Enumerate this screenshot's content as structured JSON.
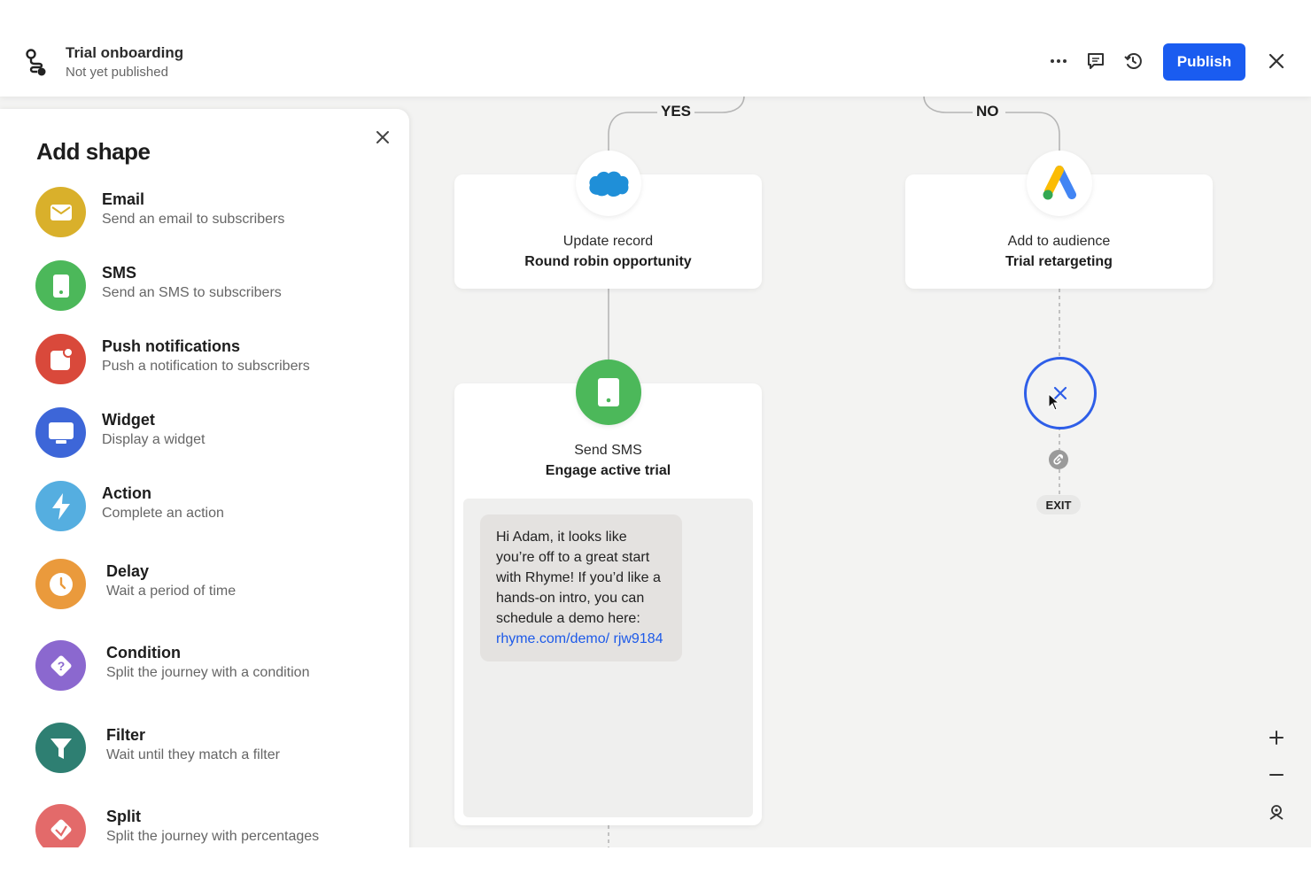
{
  "header": {
    "title": "Trial onboarding",
    "subtitle": "Not yet published",
    "publish_label": "Publish",
    "icons": [
      "flow-icon",
      "more-icon",
      "comment-icon",
      "history-icon",
      "close-icon"
    ]
  },
  "panel": {
    "title": "Add shape",
    "items": [
      {
        "name": "Email",
        "desc": "Send an email to subscribers",
        "icon": "email-icon",
        "color": "#d9b02b"
      },
      {
        "name": "SMS",
        "desc": "Send an SMS to subscribers",
        "icon": "phone-icon",
        "color": "#4cb85a"
      },
      {
        "name": "Push notifications",
        "desc": "Push a notification to subscribers",
        "icon": "push-icon",
        "color": "#d9493b"
      },
      {
        "name": "Widget",
        "desc": "Display a widget",
        "icon": "widget-icon",
        "color": "#3d66d8"
      },
      {
        "name": "Action",
        "desc": "Complete an action",
        "icon": "bolt-icon",
        "color": "#55aee0"
      },
      {
        "name": "Delay",
        "desc": "Wait a period of time",
        "icon": "clock-icon",
        "color": "#ea9a3c"
      },
      {
        "name": "Condition",
        "desc": "Split the journey with a condition",
        "icon": "question-icon",
        "color": "#8b68cf"
      },
      {
        "name": "Filter",
        "desc": "Wait until they match a filter",
        "icon": "filter-icon",
        "color": "#2e7f72"
      },
      {
        "name": "Split",
        "desc": "Split the journey with percentages",
        "icon": "split-icon",
        "color": "#e36a6a"
      }
    ]
  },
  "canvas": {
    "yes_label": "YES",
    "no_label": "NO",
    "update_node": {
      "line1": "Update record",
      "line2": "Round robin opportunity",
      "icon": "salesforce-icon"
    },
    "audience_node": {
      "line1": "Add to audience",
      "line2": "Trial retargeting",
      "icon": "google-ads-icon"
    },
    "sms_node": {
      "line1": "Send SMS",
      "line2": "Engage active trial",
      "message_text": "Hi Adam, it looks like you’re off to a great start with Rhyme! If you’d like a hands-on intro, you can schedule a demo here: ",
      "message_link": "rhyme.com/demo/ rjw9184"
    },
    "exit_label": "EXIT"
  },
  "zoom": {
    "icons": [
      "zoom-in-icon",
      "zoom-out-icon",
      "recenter-icon"
    ]
  }
}
